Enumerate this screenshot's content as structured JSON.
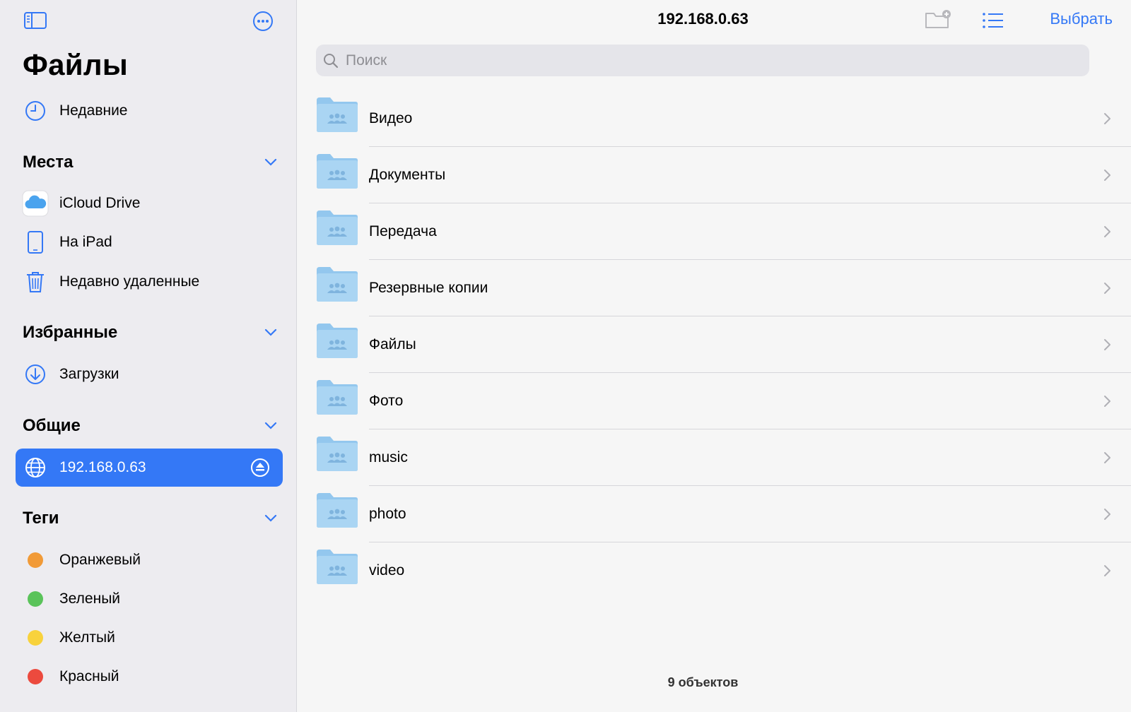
{
  "sidebar": {
    "title": "Файлы",
    "recents_label": "Недавние",
    "sections": {
      "places": "Места",
      "favorites": "Избранные",
      "shared": "Общие",
      "tags": "Теги"
    },
    "places": [
      {
        "label": "iCloud Drive",
        "icon": "icloud-icon"
      },
      {
        "label": "На iPad",
        "icon": "ipad-icon"
      },
      {
        "label": "Недавно удаленные",
        "icon": "trash-icon"
      }
    ],
    "favorites": [
      {
        "label": "Загрузки",
        "icon": "download-icon"
      }
    ],
    "shared": [
      {
        "label": "192.168.0.63",
        "icon": "globe-icon",
        "selected": true
      }
    ],
    "tags": [
      {
        "label": "Оранжевый",
        "color": "#f19a37"
      },
      {
        "label": "Зеленый",
        "color": "#5ac35a"
      },
      {
        "label": "Желтый",
        "color": "#f8d23c"
      },
      {
        "label": "Красный",
        "color": "#ec4a3e"
      }
    ]
  },
  "header": {
    "title": "192.168.0.63",
    "select_label": "Выбрать"
  },
  "search": {
    "placeholder": "Поиск"
  },
  "folders": [
    {
      "name": "Видео"
    },
    {
      "name": "Документы"
    },
    {
      "name": "Передача"
    },
    {
      "name": "Резервные копии"
    },
    {
      "name": "Файлы"
    },
    {
      "name": "Фото"
    },
    {
      "name": "music"
    },
    {
      "name": "photo"
    },
    {
      "name": "video"
    }
  ],
  "footer": {
    "count_label": "9 объектов"
  },
  "colors": {
    "accent": "#3478f6",
    "folder": "#a9d3f1"
  }
}
